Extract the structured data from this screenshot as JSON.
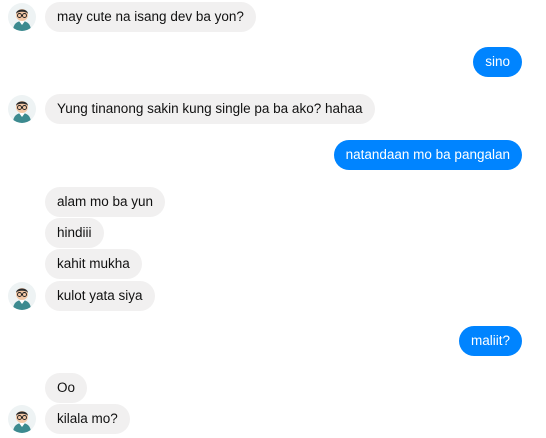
{
  "thread": {
    "messages": [
      {
        "side": "in",
        "text": "may cute na isang dev ba yon?"
      },
      {
        "side": "out",
        "text": "sino"
      },
      {
        "side": "in",
        "text": "Yung tinanong sakin kung single pa ba ako? hahaa"
      },
      {
        "side": "out",
        "text": "natandaan mo ba pangalan"
      },
      {
        "side": "in",
        "text": "alam mo ba yun"
      },
      {
        "side": "in",
        "text": "hindiii"
      },
      {
        "side": "in",
        "text": "kahit mukha"
      },
      {
        "side": "in",
        "text": "kulot yata siya"
      },
      {
        "side": "out",
        "text": "maliit?"
      },
      {
        "side": "in",
        "text": "Oo"
      },
      {
        "side": "in",
        "text": "kilala mo?"
      }
    ]
  },
  "avatar_icon": "person-with-glasses-avatar-icon",
  "colors": {
    "outgoing_bubble": "#0084ff",
    "incoming_bubble": "#f1f0f0",
    "outgoing_text": "#ffffff",
    "incoming_text": "#111111"
  }
}
